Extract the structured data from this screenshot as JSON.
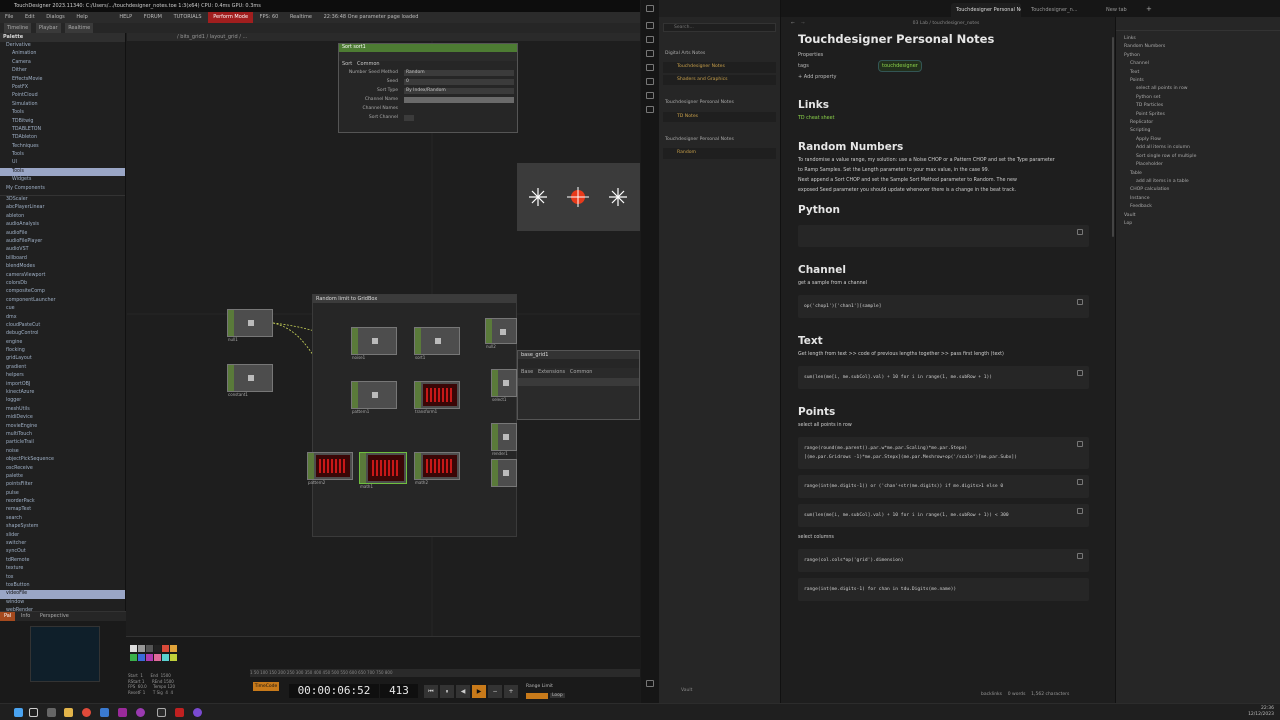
{
  "td": {
    "title": "TouchDesigner 2023.11340: C:/Users/.../touchdesigner_notes.toe   1:3(x64)   CPU: 0.4ms   GPU: 0.3ms",
    "menu": [
      "File",
      "Edit",
      "Dialogs",
      "Help",
      "HELP",
      "FORUM",
      "TUTORIALS",
      "Perform Mode",
      "FPS: 60",
      "Realtime",
      "22:36:48 One parameter page loaded"
    ],
    "toolbar": [
      "Timeline",
      "Playbar",
      "Realtime"
    ],
    "palette_title": "Palette",
    "palette_items": [
      "Derivative",
      "Animation",
      "Camera",
      "Dither",
      "EffectsMovie",
      "PostFX",
      "PointCloud",
      "Simulation",
      "Tools",
      "TDBitwig",
      "TDABLETON",
      "TDAbleton",
      "Techniques",
      "Tools",
      "UI",
      "Tools",
      "Widgets",
      "My Components"
    ],
    "palette_list": [
      "3DScaler",
      "abcPlayerLinear",
      "ableton",
      "audioAnalysis",
      "audioFile",
      "audioFilePlayer",
      "audioVST",
      "billboard",
      "blendModes",
      "cameraViewport",
      "colorsDb",
      "compositeComp",
      "componentLauncher",
      "cue",
      "dmx",
      "cloudPasteCut",
      "debugControl",
      "engine",
      "flocking",
      "gridLayout",
      "gradient",
      "helpers",
      "importOBJ",
      "kinectAzure",
      "logger",
      "meshUtils",
      "midiDevice",
      "movieEngine",
      "multiTouch",
      "particleTrail",
      "noise",
      "objectPickSequence",
      "oscReceive",
      "palette",
      "pointsFilter",
      "pulse",
      "reorderPack",
      "remapText",
      "search",
      "shapeSystem",
      "slider",
      "switcher",
      "syncOut",
      "tdRemote",
      "texture",
      "tox",
      "toxButton",
      "videoFile",
      "window",
      "webRender"
    ],
    "palette_selected": "videoFile",
    "bottom_tabs": [
      "Pal",
      "Info",
      "Perspective"
    ],
    "net_path": "/ bits_grid1 / layout_grid / ...",
    "param_header": "Sort  sort1",
    "param_tabs": [
      "Sort",
      "Common"
    ],
    "params": [
      {
        "k": "Number Seed Method",
        "v": "Random"
      },
      {
        "k": "Seed",
        "v": "0"
      },
      {
        "k": "Sort Type",
        "v": "By Index/Random"
      },
      {
        "k": "Channel Name",
        "v": ""
      },
      {
        "k": "Channel Names",
        "v": ""
      },
      {
        "k": "Sort Channel",
        "v": ""
      }
    ],
    "container_title": "Random limit to GridBox",
    "ops": [
      {
        "label": "null1"
      },
      {
        "label": "constant1"
      },
      {
        "label": "noise1"
      },
      {
        "label": "sort1"
      },
      {
        "label": "pattern1"
      },
      {
        "label": "transform1"
      },
      {
        "label": "pattern2"
      },
      {
        "label": "math1"
      },
      {
        "label": "math2"
      },
      {
        "label": "null2"
      },
      {
        "label": "select1"
      },
      {
        "label": "render1"
      }
    ],
    "subpanel_title": "base_grid1",
    "subpanel_tabs": [
      "Base",
      "Extensions",
      "Common"
    ],
    "timeline": {
      "timecode": "00:00:06:52",
      "frame": "413",
      "stats": "Start  1      End  1500\nRStart 1      REnd 1500\nFPS  60.0     Tempo 120\nResetF 1      T Sig  4  4",
      "ruler": "1    50    100    150    200    250    300    350    400    450    500    550    600    650    700    750    800",
      "range_label": "Range Limit",
      "mode_label": "TimeCode",
      "loop_label": "Loop"
    }
  },
  "obs": {
    "tabs": [
      "Touchdesigner Personal Notes",
      "Touchdesigner_n...",
      "New tab"
    ],
    "nav_title": "03 Lab / touchdesigner_notes",
    "search_placeholder": "Search...",
    "side_groups": [
      {
        "title": "Digital Arts Notes",
        "items": [
          "Touchdesigner Notes",
          "Shaders and Graphics"
        ]
      },
      {
        "title": "Touchdesigner Personal Notes",
        "items": [
          "TD Notes"
        ]
      },
      {
        "title": "Touchdesigner Personal Notes",
        "items": [
          "Random"
        ]
      }
    ],
    "side_bottom": "Vault",
    "doc": {
      "title": "Touchdesigner Personal Notes",
      "properties_label": "Properties",
      "tags_key": "tags",
      "tags_val": "touchdesigner",
      "add_property": "+ Add property",
      "links_h": "Links",
      "link": "TD cheat sheet",
      "random_h": "Random Numbers",
      "random_p1": "To randomise a value range, my solution: use a Noise CHOP or a Pattern CHOP and set the Type parameter",
      "random_p2": "to Ramp Samples. Set the Length parameter to your max value, in the case 99.",
      "random_p3": "Next append a Sort CHOP and set the Sample Sort Method parameter to Random. The new",
      "random_p4": "exposed Seed parameter you should update whenever there is a change in the beat track.",
      "python_h": "Python",
      "channel_h": "Channel",
      "channel_p": "get a sample from a channel",
      "channel_code": "op('chop1')['chan1'][sample]",
      "text_h": "Text",
      "text_p": "Get length from text >> code of previous lengths together >> pass first length (text)",
      "text_code": "sum(len(me[i, me.subCol].val) + 10 for i in range(1, me.subRow + 1))",
      "points_h": "Points",
      "points_p": "select all points in row",
      "points_code1": "range(round(me.parent().par.w*me.par.Scaling)*me.par.Stepx)",
      "points_code1b": "[(me.par.Gridrows -1)*me.par.Stepx](me.par.Meshrow+op('/scale')[me.par.Subx])",
      "points_code2": "range(int(me.digits-1)) or ('chan'+str(me.digits)) if me.digits>1 else 0",
      "points_code3": "sum(len(me[i, me.subCol].val) + 10 for i in range(1, me.subRow + 1)) < 300",
      "cols_p": "select columns",
      "cols_code": "range(col.cols*op('grid').dimension)",
      "last_code": "range(int(me.digits-1) for chan in tdu.Digits(me.name))"
    },
    "outline": [
      "Links",
      "Random Numbers",
      "Python",
      "Channel",
      "Text",
      "Points",
      "select all points in row",
      "Python set",
      "TD Particles",
      "Point Sprites",
      "Replicator",
      "Scripting",
      "Apply Flow",
      "Add all items in column",
      "Sort single row of multiple",
      "Placeholder",
      "Table",
      "add all items in a table",
      "CHOP calculation",
      "Instance",
      "Feedback",
      "Vault",
      "Lop"
    ],
    "status": [
      "backlinks",
      "0 words",
      "1,562 characters"
    ]
  },
  "taskbar": {
    "time": "22:36",
    "date": "12/12/2023"
  },
  "colors": {
    "td_bg": "#1e1e1e",
    "op_green": "#5a7a3a",
    "op_red": "#b01010",
    "tag_green": "#8bd34a",
    "palette_sel": "#9aa6c6"
  }
}
